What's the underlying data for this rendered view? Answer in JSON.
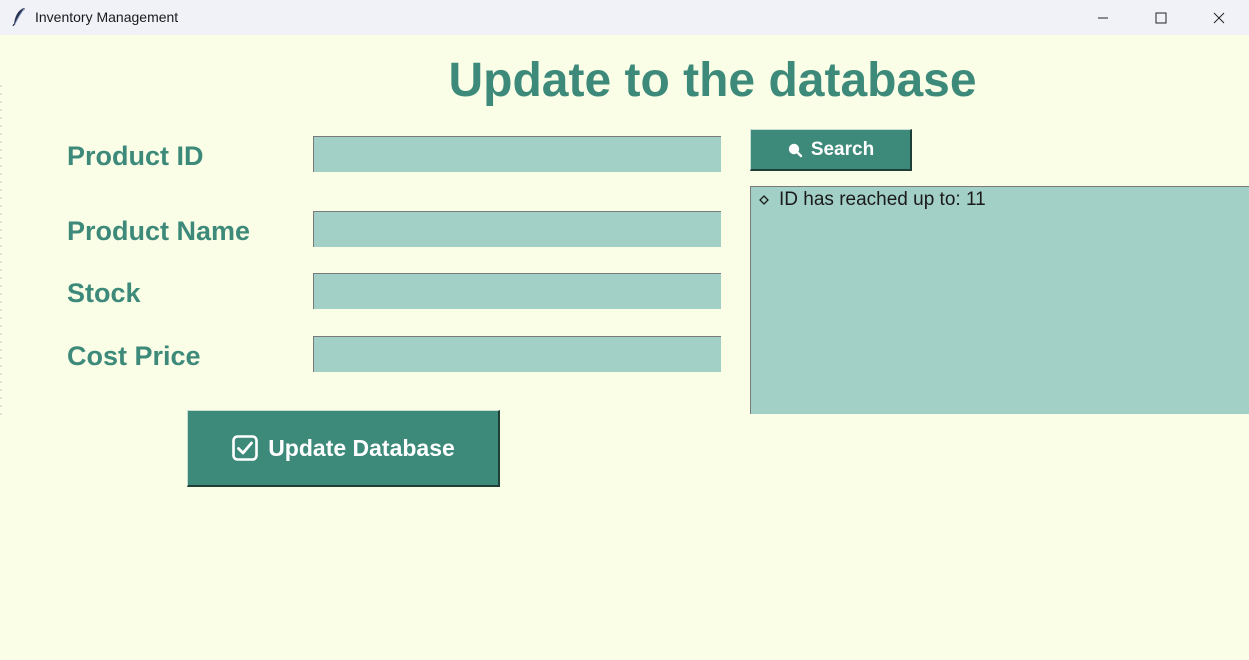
{
  "window": {
    "title": "Inventory Management",
    "icon": "feather-icon",
    "controls": [
      "minimize-icon",
      "maximize-icon",
      "close-icon"
    ]
  },
  "heading": "Update to the database",
  "form": {
    "fields": [
      {
        "label": "Product ID",
        "value": "",
        "placeholder": ""
      },
      {
        "label": "Product Name",
        "value": "",
        "placeholder": ""
      },
      {
        "label": "Stock",
        "value": "",
        "placeholder": ""
      },
      {
        "label": "Cost Price",
        "value": "",
        "placeholder": ""
      }
    ]
  },
  "search_button": {
    "label": "Search",
    "icon": "search-icon"
  },
  "info_panel": {
    "items": [
      {
        "text": "ID has reached up to: 11",
        "icon": "diamond-bullet-icon"
      }
    ]
  },
  "update_button": {
    "label": "Update Database",
    "icon": "checkbox-icon"
  },
  "colors": {
    "background": "#fafee6",
    "accent": "#3d8a7a",
    "input_fill": "#a3d0c6",
    "titlebar": "#f1f2f8"
  }
}
